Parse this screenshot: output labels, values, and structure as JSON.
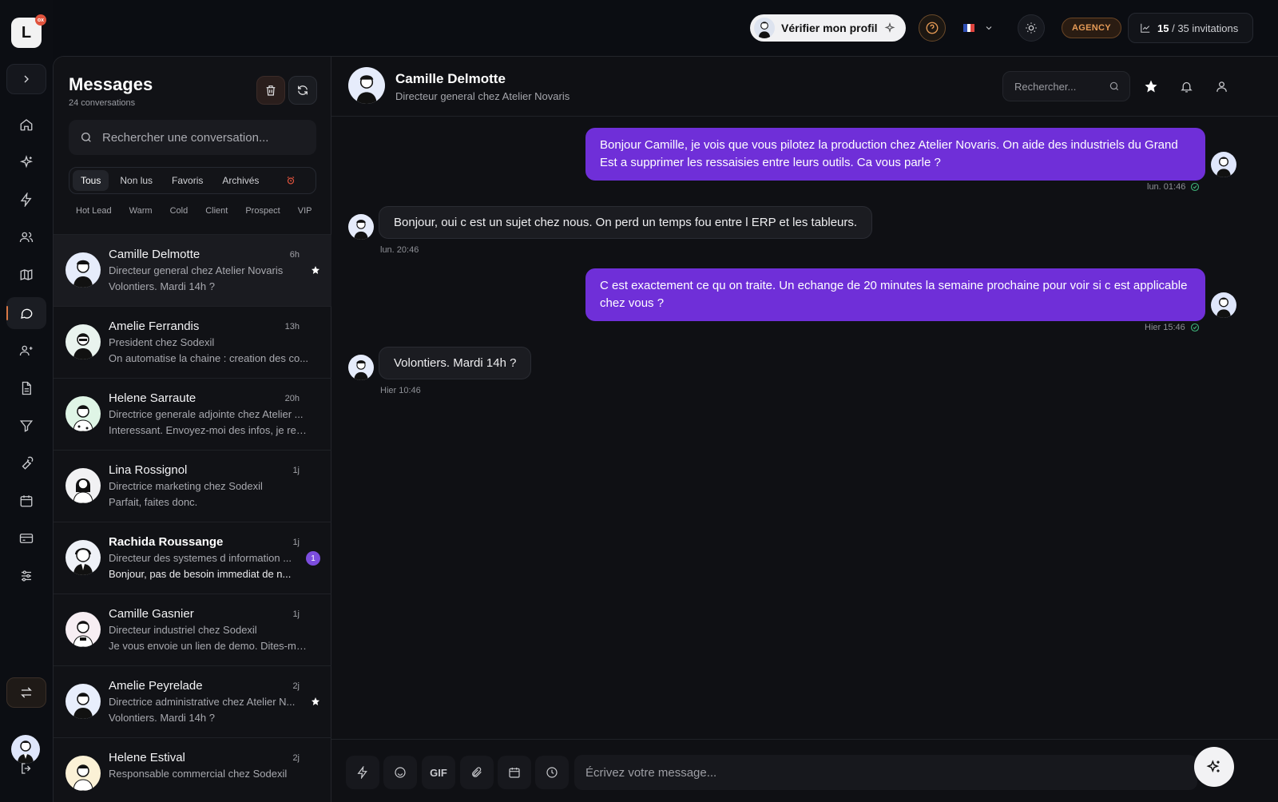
{
  "app": {
    "logo_letter": "L",
    "logo_badge": "ox"
  },
  "rail": {
    "icons": [
      "home-icon",
      "sparkles-icon",
      "bolt-icon",
      "users-icon",
      "map-icon",
      "chat-icon",
      "contacts-icon",
      "document-icon",
      "filter-icon",
      "wrench-icon",
      "calendar-icon",
      "card-icon",
      "sliders-icon"
    ],
    "active": "chat-icon"
  },
  "topbar": {
    "verify_label": "Vérifier mon profil",
    "agency_label": "AGENCY",
    "invitations_used": "15",
    "invitations_total": "/ 35 invitations",
    "accent": "#d97745"
  },
  "sidebar": {
    "title": "Messages",
    "subtitle": "24 conversations",
    "search_placeholder": "Rechercher une conversation...",
    "tabs": [
      "Tous",
      "Non lus",
      "Favoris",
      "Archivés"
    ],
    "active_tab": "Tous",
    "tags": [
      "Hot Lead",
      "Warm",
      "Cold",
      "Client",
      "Prospect",
      "VIP"
    ],
    "conversations": [
      {
        "name": "Camille Delmotte",
        "time": "6h",
        "role": "Directeur general chez Atelier Novaris",
        "preview": "Volontiers. Mardi 14h ?",
        "starred": true,
        "unread": 0,
        "selected": true
      },
      {
        "name": "Amelie Ferrandis",
        "time": "13h",
        "role": "President chez Sodexil",
        "preview": "On automatise la chaine : creation des co...",
        "starred": false,
        "unread": 0
      },
      {
        "name": "Helene Sarraute",
        "time": "20h",
        "role": "Directrice generale adjointe chez Atelier ...",
        "preview": "Interessant. Envoyez-moi des infos, je reg...",
        "starred": false,
        "unread": 0
      },
      {
        "name": "Lina Rossignol",
        "time": "1j",
        "role": "Directrice marketing chez Sodexil",
        "preview": "Parfait, faites donc.",
        "starred": false,
        "unread": 0
      },
      {
        "name": "Rachida Roussange",
        "time": "1j",
        "role": "Directeur des systemes d information ...",
        "preview": "Bonjour, pas de besoin immediat de n...",
        "starred": false,
        "unread": 1
      },
      {
        "name": "Camille Gasnier",
        "time": "1j",
        "role": "Directeur industriel chez Sodexil",
        "preview": "Je vous envoie un lien de demo. Dites-moi...",
        "starred": false,
        "unread": 0
      },
      {
        "name": "Amelie Peyrelade",
        "time": "2j",
        "role": "Directrice administrative chez Atelier N...",
        "preview": "Volontiers. Mardi 14h ?",
        "starred": true,
        "unread": 0
      },
      {
        "name": "Helene Estival",
        "time": "2j",
        "role": "Responsable commercial chez Sodexil",
        "preview": "",
        "starred": false,
        "unread": 0
      }
    ]
  },
  "chat": {
    "contact_name": "Camille Delmotte",
    "contact_role": "Directeur general chez Atelier Novaris",
    "search_placeholder": "Rechercher...",
    "messages": [
      {
        "direction": "out",
        "text": "Bonjour Camille, je vois que vous pilotez la production chez Atelier Novaris. On aide des industriels du Grand Est a supprimer les ressaisies entre leurs outils. Ca vous parle ?",
        "time": "lun. 01:46"
      },
      {
        "direction": "in",
        "text": "Bonjour, oui c est un sujet chez nous. On perd un temps fou entre l ERP et les tableurs.",
        "time": "lun. 20:46"
      },
      {
        "direction": "out",
        "text": "C est exactement ce qu on traite. Un echange de 20 minutes la semaine prochaine pour voir si c est applicable chez vous ?",
        "time": "Hier 15:46"
      },
      {
        "direction": "in",
        "text": "Volontiers. Mardi 14h ?",
        "time": "Hier 10:46"
      }
    ],
    "composer_placeholder": "Écrivez votre message...",
    "gif_label": "GIF",
    "bubble_color": "#6f2fd8"
  }
}
